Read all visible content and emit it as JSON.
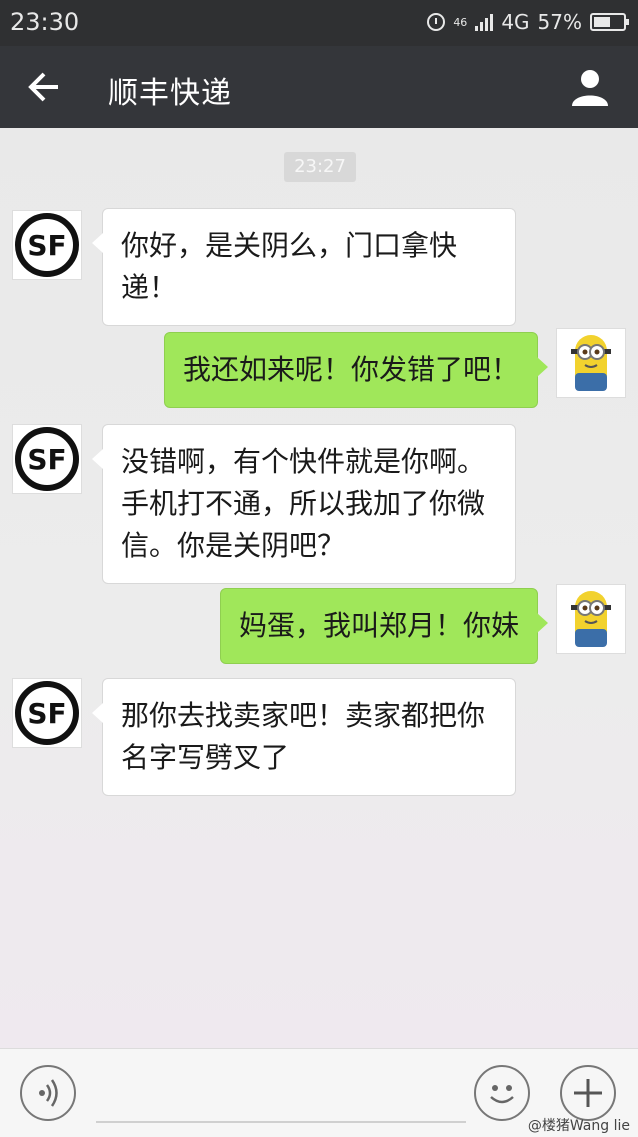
{
  "status_bar": {
    "time": "23:30",
    "network": "4G",
    "network_small": "46",
    "battery_percent": "57%",
    "battery_level": 0.57,
    "icons": [
      "alarm-icon",
      "signal-icon",
      "battery-icon"
    ]
  },
  "header": {
    "title": "顺丰快递",
    "back_icon": "back-arrow-icon",
    "profile_icon": "profile-icon"
  },
  "chat": {
    "timestamp": "23:27",
    "messages": [
      {
        "sender": "them",
        "avatar": "sf-logo",
        "text_lines": [
          "你好，是关阴么，门口拿快",
          "递！"
        ]
      },
      {
        "sender": "me",
        "avatar": "minion-avatar",
        "text_lines": [
          "我还如来呢！你发错了吧！"
        ]
      },
      {
        "sender": "them",
        "avatar": "sf-logo",
        "text_lines": [
          "没错啊，有个快件就是你啊。",
          "手机打不通，所以我加了你微",
          "信。你是关阴吧？"
        ]
      },
      {
        "sender": "me",
        "avatar": "minion-avatar",
        "text_lines": [
          "妈蛋，我叫郑月！你妹"
        ]
      },
      {
        "sender": "them",
        "avatar": "sf-logo",
        "text_lines": [
          "那你去找卖家吧！卖家都把你",
          "名字写劈叉了"
        ]
      }
    ]
  },
  "input_bar": {
    "voice_icon": "voice-icon",
    "emoji_icon": "emoji-icon",
    "plus_icon": "plus-icon",
    "watermark": "@楼猪Wang lie"
  },
  "colors": {
    "header_bg": "#34363a",
    "status_bg": "#2f3032",
    "sent_bubble": "#a0e75a",
    "received_bubble": "#ffffff"
  }
}
